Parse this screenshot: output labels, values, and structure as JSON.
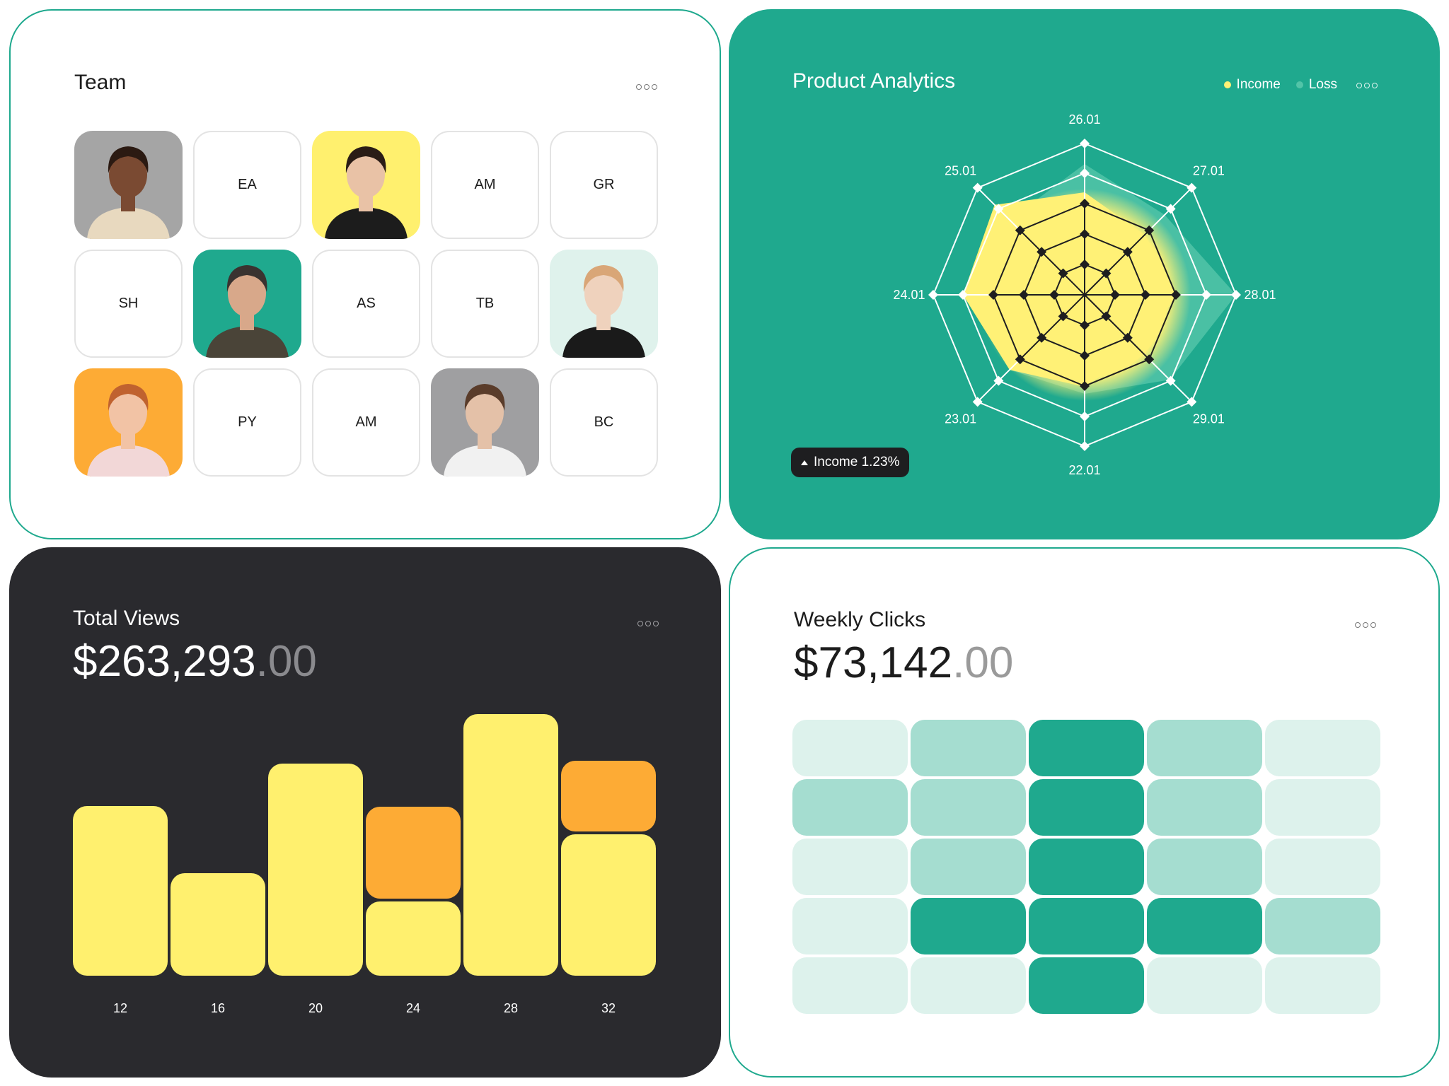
{
  "team": {
    "title": "Team",
    "members": [
      {
        "initials": "",
        "photo": "man-curly"
      },
      {
        "initials": "EA"
      },
      {
        "initials": "",
        "photo": "woman-yellow"
      },
      {
        "initials": "AM"
      },
      {
        "initials": "GR"
      },
      {
        "initials": "SH"
      },
      {
        "initials": "",
        "photo": "man-beard"
      },
      {
        "initials": "AS"
      },
      {
        "initials": "TB"
      },
      {
        "initials": "",
        "photo": "woman-profile"
      },
      {
        "initials": "",
        "photo": "man-ginger"
      },
      {
        "initials": "PY"
      },
      {
        "initials": "AM"
      },
      {
        "initials": "",
        "photo": "woman-grey"
      },
      {
        "initials": "BC"
      }
    ]
  },
  "analytics": {
    "title": "Product Analytics",
    "legend": [
      {
        "label": "Income",
        "color": "#fff176"
      },
      {
        "label": "Loss",
        "color": "#52c4a8"
      }
    ],
    "badge": "Income 1.23%",
    "axes": [
      "26.01",
      "27.01",
      "28.01",
      "29.01",
      "22.01",
      "23.01",
      "24.01",
      "25.01"
    ]
  },
  "views": {
    "title": "Total Views",
    "amount": "$263,293",
    "cents": ".00"
  },
  "clicks": {
    "title": "Weekly Clicks",
    "amount": "$73,142",
    "cents": ".00"
  },
  "chart_data": [
    {
      "type": "bar",
      "categories": [
        "12",
        "16",
        "20",
        "24",
        "28",
        "32"
      ],
      "series": [
        {
          "values": [
            240,
            145,
            300,
            105,
            370,
            200
          ],
          "color": "#fff06e"
        },
        {
          "values": [
            0,
            0,
            0,
            130,
            0,
            100
          ],
          "color": "#fdab35"
        }
      ],
      "ylim": [
        0,
        370
      ]
    },
    {
      "type": "heatmap",
      "levels": [
        [
          0,
          1,
          3,
          1,
          0
        ],
        [
          1,
          1,
          3,
          1,
          0
        ],
        [
          0,
          1,
          3,
          1,
          0
        ],
        [
          0,
          3,
          3,
          3,
          1
        ],
        [
          0,
          0,
          3,
          0,
          0
        ]
      ],
      "colors": [
        "#ddf2ec",
        "#a5ddd0",
        "#1fa98e",
        "#1fa98e"
      ]
    }
  ],
  "colors": {
    "accent": "#1fa98e",
    "yellow": "#fff06e",
    "orange": "#fdab35",
    "dark": "#2a2a2e"
  }
}
